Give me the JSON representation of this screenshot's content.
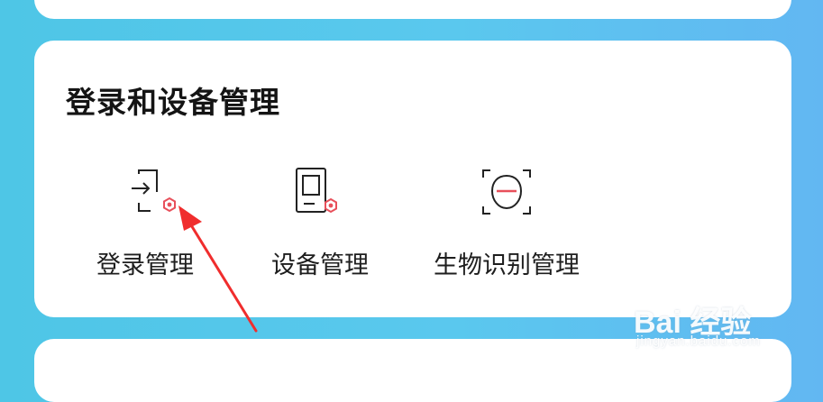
{
  "section": {
    "title": "登录和设备管理",
    "items": [
      {
        "label": "登录管理",
        "icon": "login-icon"
      },
      {
        "label": "设备管理",
        "icon": "device-icon"
      },
      {
        "label": "生物识别管理",
        "icon": "face-recognition-icon"
      }
    ]
  },
  "annotation": {
    "icon": "red-arrow-icon",
    "color": "#f02d2d"
  },
  "watermark": {
    "logo_text": "Bai 经验",
    "url": "jingyan.baidu.com"
  },
  "colors": {
    "background": "#5ac8ee",
    "card": "#ffffff",
    "icon_stroke": "#222222",
    "icon_accent": "#e8505b",
    "arrow": "#f02d2d"
  }
}
